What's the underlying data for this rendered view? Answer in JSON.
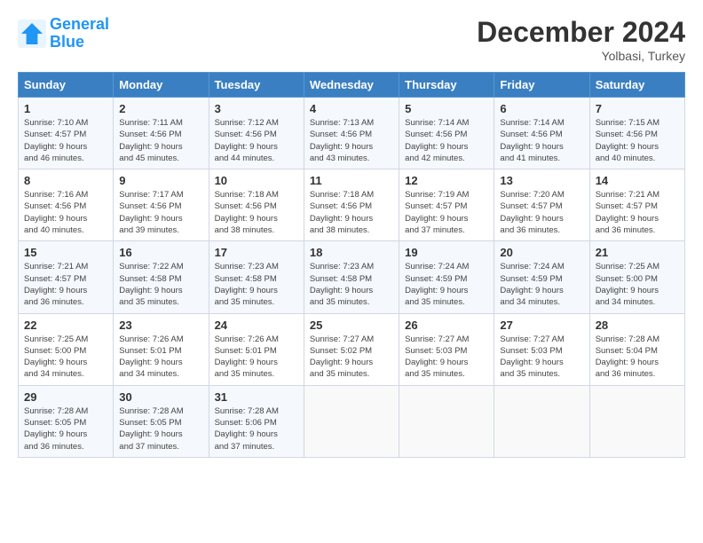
{
  "header": {
    "logo_line1": "General",
    "logo_line2": "Blue",
    "month": "December 2024",
    "location": "Yolbasi, Turkey"
  },
  "weekdays": [
    "Sunday",
    "Monday",
    "Tuesday",
    "Wednesday",
    "Thursday",
    "Friday",
    "Saturday"
  ],
  "weeks": [
    [
      {
        "day": "1",
        "info": "Sunrise: 7:10 AM\nSunset: 4:57 PM\nDaylight: 9 hours\nand 46 minutes."
      },
      {
        "day": "2",
        "info": "Sunrise: 7:11 AM\nSunset: 4:56 PM\nDaylight: 9 hours\nand 45 minutes."
      },
      {
        "day": "3",
        "info": "Sunrise: 7:12 AM\nSunset: 4:56 PM\nDaylight: 9 hours\nand 44 minutes."
      },
      {
        "day": "4",
        "info": "Sunrise: 7:13 AM\nSunset: 4:56 PM\nDaylight: 9 hours\nand 43 minutes."
      },
      {
        "day": "5",
        "info": "Sunrise: 7:14 AM\nSunset: 4:56 PM\nDaylight: 9 hours\nand 42 minutes."
      },
      {
        "day": "6",
        "info": "Sunrise: 7:14 AM\nSunset: 4:56 PM\nDaylight: 9 hours\nand 41 minutes."
      },
      {
        "day": "7",
        "info": "Sunrise: 7:15 AM\nSunset: 4:56 PM\nDaylight: 9 hours\nand 40 minutes."
      }
    ],
    [
      {
        "day": "8",
        "info": "Sunrise: 7:16 AM\nSunset: 4:56 PM\nDaylight: 9 hours\nand 40 minutes."
      },
      {
        "day": "9",
        "info": "Sunrise: 7:17 AM\nSunset: 4:56 PM\nDaylight: 9 hours\nand 39 minutes."
      },
      {
        "day": "10",
        "info": "Sunrise: 7:18 AM\nSunset: 4:56 PM\nDaylight: 9 hours\nand 38 minutes."
      },
      {
        "day": "11",
        "info": "Sunrise: 7:18 AM\nSunset: 4:56 PM\nDaylight: 9 hours\nand 38 minutes."
      },
      {
        "day": "12",
        "info": "Sunrise: 7:19 AM\nSunset: 4:57 PM\nDaylight: 9 hours\nand 37 minutes."
      },
      {
        "day": "13",
        "info": "Sunrise: 7:20 AM\nSunset: 4:57 PM\nDaylight: 9 hours\nand 36 minutes."
      },
      {
        "day": "14",
        "info": "Sunrise: 7:21 AM\nSunset: 4:57 PM\nDaylight: 9 hours\nand 36 minutes."
      }
    ],
    [
      {
        "day": "15",
        "info": "Sunrise: 7:21 AM\nSunset: 4:57 PM\nDaylight: 9 hours\nand 36 minutes."
      },
      {
        "day": "16",
        "info": "Sunrise: 7:22 AM\nSunset: 4:58 PM\nDaylight: 9 hours\nand 35 minutes."
      },
      {
        "day": "17",
        "info": "Sunrise: 7:23 AM\nSunset: 4:58 PM\nDaylight: 9 hours\nand 35 minutes."
      },
      {
        "day": "18",
        "info": "Sunrise: 7:23 AM\nSunset: 4:58 PM\nDaylight: 9 hours\nand 35 minutes."
      },
      {
        "day": "19",
        "info": "Sunrise: 7:24 AM\nSunset: 4:59 PM\nDaylight: 9 hours\nand 35 minutes."
      },
      {
        "day": "20",
        "info": "Sunrise: 7:24 AM\nSunset: 4:59 PM\nDaylight: 9 hours\nand 34 minutes."
      },
      {
        "day": "21",
        "info": "Sunrise: 7:25 AM\nSunset: 5:00 PM\nDaylight: 9 hours\nand 34 minutes."
      }
    ],
    [
      {
        "day": "22",
        "info": "Sunrise: 7:25 AM\nSunset: 5:00 PM\nDaylight: 9 hours\nand 34 minutes."
      },
      {
        "day": "23",
        "info": "Sunrise: 7:26 AM\nSunset: 5:01 PM\nDaylight: 9 hours\nand 34 minutes."
      },
      {
        "day": "24",
        "info": "Sunrise: 7:26 AM\nSunset: 5:01 PM\nDaylight: 9 hours\nand 35 minutes."
      },
      {
        "day": "25",
        "info": "Sunrise: 7:27 AM\nSunset: 5:02 PM\nDaylight: 9 hours\nand 35 minutes."
      },
      {
        "day": "26",
        "info": "Sunrise: 7:27 AM\nSunset: 5:03 PM\nDaylight: 9 hours\nand 35 minutes."
      },
      {
        "day": "27",
        "info": "Sunrise: 7:27 AM\nSunset: 5:03 PM\nDaylight: 9 hours\nand 35 minutes."
      },
      {
        "day": "28",
        "info": "Sunrise: 7:28 AM\nSunset: 5:04 PM\nDaylight: 9 hours\nand 36 minutes."
      }
    ],
    [
      {
        "day": "29",
        "info": "Sunrise: 7:28 AM\nSunset: 5:05 PM\nDaylight: 9 hours\nand 36 minutes."
      },
      {
        "day": "30",
        "info": "Sunrise: 7:28 AM\nSunset: 5:05 PM\nDaylight: 9 hours\nand 37 minutes."
      },
      {
        "day": "31",
        "info": "Sunrise: 7:28 AM\nSunset: 5:06 PM\nDaylight: 9 hours\nand 37 minutes."
      },
      {
        "day": "",
        "info": ""
      },
      {
        "day": "",
        "info": ""
      },
      {
        "day": "",
        "info": ""
      },
      {
        "day": "",
        "info": ""
      }
    ]
  ]
}
